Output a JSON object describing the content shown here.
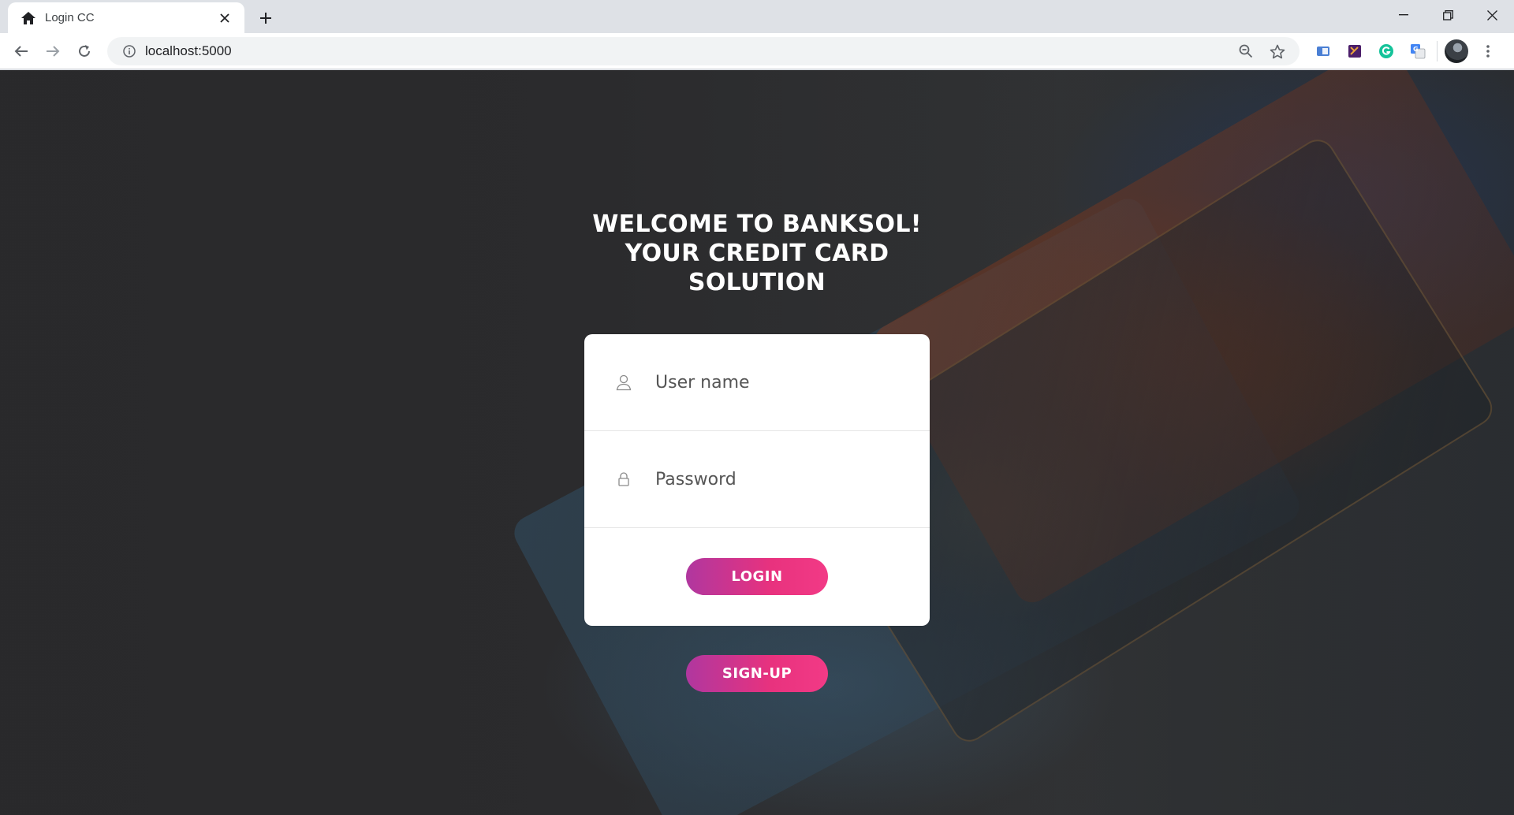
{
  "browser": {
    "tab_title": "Login CC",
    "url": "localhost:5000",
    "icons": {
      "favicon": "home-icon",
      "close": "close-icon",
      "new_tab": "plus-icon",
      "back": "arrow-left-icon",
      "forward": "arrow-right-icon",
      "reload": "reload-icon",
      "site_info": "info-icon",
      "zoom": "zoom-out-icon",
      "bookmark": "star-icon",
      "menu": "kebab-menu-icon"
    },
    "extensions": [
      "extension-blue-icon",
      "extension-purple-icon",
      "grammarly-icon",
      "google-translate-icon",
      "profile-avatar"
    ]
  },
  "page": {
    "headline": [
      "WELCOME TO BANKSOL!",
      "YOUR CREDIT CARD",
      "SOLUTION"
    ],
    "username_placeholder": "User name",
    "password_placeholder": "Password",
    "login_label": "LOGIN",
    "signup_label": "SIGN-UP",
    "colors": {
      "button_start": "#b0379f",
      "button_end": "#f23a86",
      "card_bg": "#ffffff",
      "headline": "#ffffff"
    }
  }
}
